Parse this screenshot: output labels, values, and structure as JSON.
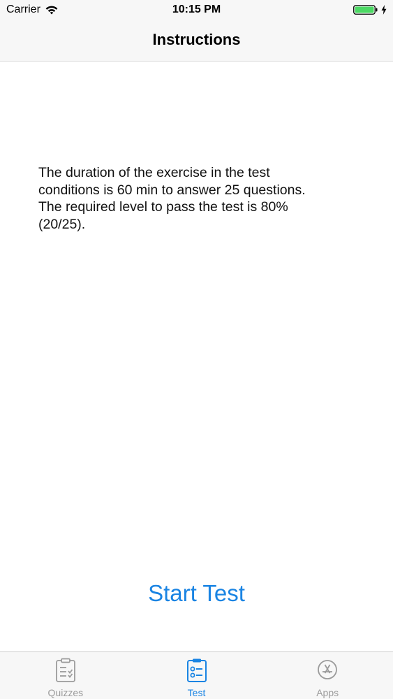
{
  "status_bar": {
    "carrier": "Carrier",
    "time": "10:15 PM",
    "battery_level": 1.0,
    "charging": true
  },
  "nav": {
    "title": "Instructions"
  },
  "instructions": {
    "line1": "The duration of the exercise in the test",
    "line2": "conditions is 60 min to answer 25 questions.",
    "line3": "The required level to pass the test is 80%",
    "line4": "(20/25)."
  },
  "start_button_label": "Start Test",
  "tabs": [
    {
      "label": "Quizzes",
      "icon": "clipboard-check-icon",
      "active": false
    },
    {
      "label": "Test",
      "icon": "clipboard-list-icon",
      "active": true
    },
    {
      "label": "Apps",
      "icon": "app-store-icon",
      "active": false
    }
  ],
  "colors": {
    "accent": "#1a84e3",
    "inactive": "#9b9b9b",
    "battery": "#4cd964",
    "bar_background": "#f7f7f7"
  }
}
